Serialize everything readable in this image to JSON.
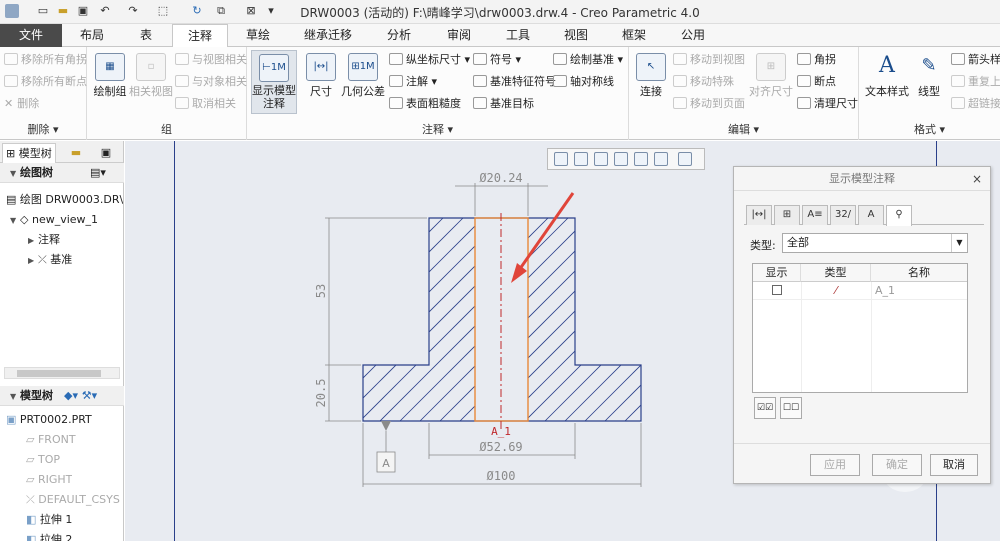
{
  "window": {
    "title": "DRW0003 (活动的) F:\\晴峰学习\\drw0003.drw.4 - Creo Parametric 4.0"
  },
  "quick_access": [
    "new-icon",
    "open-icon",
    "save-icon",
    "undo-icon",
    "redo-icon",
    "select-box-icon",
    "regenerate-icon",
    "window-icon",
    "close-window-icon",
    "customize-icon"
  ],
  "tabs": [
    "文件",
    "布局",
    "表",
    "注释",
    "草绘",
    "继承迁移",
    "分析",
    "审阅",
    "工具",
    "视图",
    "框架",
    "公用"
  ],
  "active_tab": "注释",
  "ribbon": {
    "delete_group": {
      "label": "删除 ▾",
      "items": [
        "移除所有角拐",
        "移除所有断点",
        "删除"
      ]
    },
    "group_group": {
      "label": "组",
      "items": [
        "与视图相关",
        "与对象相关",
        "取消相关"
      ],
      "buttons": [
        "绘制组",
        "相关视图"
      ]
    },
    "annotation_group": {
      "label": "注释 ▾",
      "show_model": "显示模型\n注释",
      "dim": "尺寸",
      "geom_tol": "几何公差",
      "items": [
        "纵坐标尺寸 ▾",
        "注解 ▾",
        "表面粗糙度",
        "符号 ▾",
        "基准特征符号",
        "基准目标",
        "绘制基准 ▾",
        "轴对称线"
      ]
    },
    "edit_group": {
      "label": "编辑 ▾",
      "connect": "连接",
      "align_dim": "对齐尺寸",
      "items": [
        "移动到视图",
        "移动特殊",
        "移动到页面",
        "角拐",
        "断点",
        "清理尺寸"
      ]
    },
    "format_group": {
      "label": "格式 ▾",
      "text_style": "文本样式",
      "line_style": "线型",
      "items": [
        "箭头样式",
        "重复上一格式",
        "超链接"
      ]
    }
  },
  "left_panel": {
    "tabs": [
      "模型树"
    ],
    "drawing_tree_title": "绘图树",
    "drawing_tree": [
      "绘图 DRW0003.DR\\",
      "new_view_1",
      "注释",
      "基准"
    ],
    "model_tree_title": "模型树",
    "model_tree": [
      "PRT0002.PRT",
      "FRONT",
      "TOP",
      "RIGHT",
      "DEFAULT_CSYS",
      "拉伸 1",
      "拉伸 2"
    ]
  },
  "drawing": {
    "dim_top": "Ø20.24",
    "dim_mid": "Ø52.69",
    "dim_bottom": "Ø100",
    "dim_height_upper": "53",
    "dim_height_lower": "20.5",
    "axis_label": "A_1",
    "datum_label": "A",
    "colors": {
      "outline": "#2a3f8a",
      "hatch": "#2a3f8a",
      "hole": "#e8893a",
      "axis": "#c0282c",
      "dimension": "#8a8a8a",
      "arrow": "#e0453a"
    }
  },
  "dialog": {
    "title": "显示模型注释",
    "close": "×",
    "tabs": [
      "|↔|",
      "⊞",
      "A≡",
      "32/",
      "A",
      "⚲"
    ],
    "type_label": "类型:",
    "type_value": "全部",
    "columns": [
      "显示",
      "类型",
      "名称"
    ],
    "rows": [
      {
        "show": false,
        "type_icon": "axis-icon",
        "name": "A_1"
      }
    ],
    "buttons": {
      "ok": "确定",
      "apply": "应用",
      "cancel": "取消"
    }
  }
}
